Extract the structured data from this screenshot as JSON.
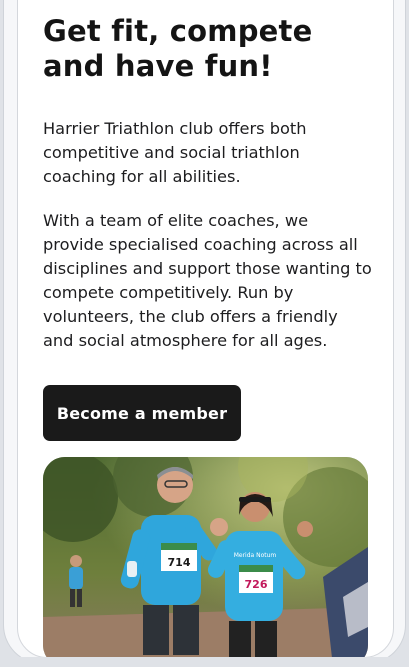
{
  "hero": {
    "headline": "Get fit, compete and have fun!",
    "paragraph_1": "Harrier Triathlon club offers both competitive and social triathlon coaching for all abilities.",
    "paragraph_2": "With a team of elite coaches, we provide specialised coaching across all disciplines and support those wanting to compete competitively. Run by volunteers, the club offers a friendly and social atmosphere for all ages.",
    "cta_label": "Become a member"
  },
  "photo": {
    "bib_left": "714",
    "bib_right": "726",
    "shirt_text": "Merida Notum"
  },
  "colors": {
    "button_bg": "#1a1a1a",
    "text": "#141414",
    "shirt_blue": "#2fa6dc"
  }
}
